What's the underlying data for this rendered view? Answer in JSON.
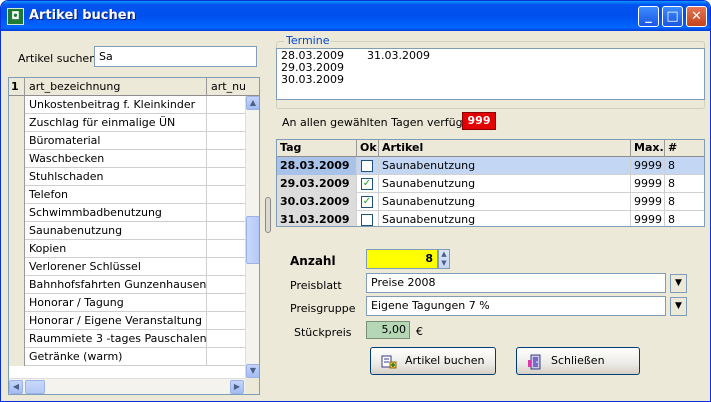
{
  "window": {
    "title": "Artikel buchen",
    "minimize": "_",
    "maximize": "□",
    "close": "✕",
    "icon": "app-icon"
  },
  "search": {
    "label": "Artikel suchen",
    "value": "Sa"
  },
  "articles": {
    "indicator": "1",
    "columns": [
      "art_bezeichnung",
      "art_nu"
    ],
    "rows": [
      "Unkostenbeitrag f. Kleinkinder",
      "Zuschlag für einmalige ÜN",
      "Büromaterial",
      "Waschbecken",
      "Stuhlschaden",
      "Telefon",
      "Schwimmbadbenutzung",
      "Saunabenutzung",
      "Kopien",
      "Verlorener Schlüssel",
      "Bahnhofsfahrten Gunzenhausen",
      "Honorar / Tagung",
      "Honorar / Eigene Veranstaltung",
      "Raummiete 3 -tages Pauschalen",
      "Getränke (warm)"
    ]
  },
  "termine": {
    "legend": "Termine",
    "lines": [
      [
        "28.03.2009",
        "31.03.2009"
      ],
      [
        "29.03.2009",
        ""
      ],
      [
        "30.03.2009",
        ""
      ]
    ]
  },
  "availability": {
    "label": "An allen gewählten Tagen verfügbar:",
    "value": "999"
  },
  "booking": {
    "columns": {
      "tag": "Tag",
      "ok": "Ok",
      "artikel": "Artikel",
      "max": "Max.",
      "nr": "#"
    },
    "rows": [
      {
        "tag": "28.03.2009",
        "ok": false,
        "artikel": "Saunabenutzung",
        "max": "9999",
        "nr": "8",
        "selected": true
      },
      {
        "tag": "29.03.2009",
        "ok": true,
        "artikel": "Saunabenutzung",
        "max": "9999",
        "nr": "8",
        "selected": false
      },
      {
        "tag": "30.03.2009",
        "ok": true,
        "artikel": "Saunabenutzung",
        "max": "9999",
        "nr": "8",
        "selected": false
      },
      {
        "tag": "31.03.2009",
        "ok": false,
        "artikel": "Saunabenutzung",
        "max": "9999",
        "nr": "8",
        "selected": false
      }
    ]
  },
  "form": {
    "anzahl_label": "Anzahl",
    "anzahl_value": "8",
    "preisblatt_label": "Preisblatt",
    "preisblatt_value": "Preise 2008",
    "preisgruppe_label": "Preisgruppe",
    "preisgruppe_value": "Eigene Tagungen 7 %",
    "stueckpreis_label": "Stückpreis",
    "stueckpreis_value": "5,00",
    "currency": "€"
  },
  "buttons": {
    "book": "Artikel buchen",
    "close": "Schließen"
  },
  "colors": {
    "title_bar": "#0053ee",
    "availability_bg": "#e30000",
    "anzahl_bg": "#ffff00",
    "price_bg": "#b5d7b5",
    "selected_row": "#c3d7f5"
  }
}
